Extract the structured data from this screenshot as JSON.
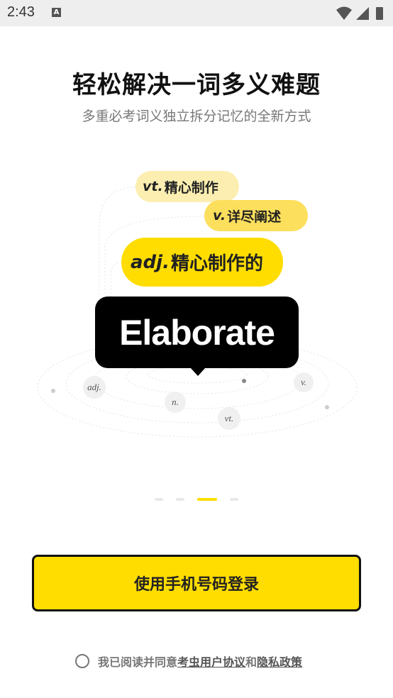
{
  "status_bar": {
    "time": "2:43",
    "notification_glyph": "A",
    "icons": [
      "wifi-icon",
      "cell-signal-icon",
      "battery-icon"
    ]
  },
  "headline": {
    "title": "轻松解决一词多义难题",
    "subtitle": "多重必考词义独立拆分记忆的全新方式"
  },
  "illustration": {
    "word": "Elaborate",
    "meanings": [
      {
        "pos": "vt.",
        "text": "精心制作"
      },
      {
        "pos": "v.",
        "text": "详尽阐述"
      },
      {
        "pos": "adj.",
        "text": "精心制作的"
      }
    ],
    "orbit_labels": [
      "adj.",
      "n.",
      "vt.",
      "v."
    ]
  },
  "pager": {
    "count": 4,
    "active_index": 2,
    "active_color": "#ffdd00",
    "inactive_color": "#e8e8e8"
  },
  "login": {
    "button_label": "使用手机号码登录"
  },
  "agreement": {
    "prefix": "我已阅读并同意",
    "user_agreement": "考虫用户协议",
    "and": "和",
    "privacy_policy": "隐私政策"
  },
  "colors": {
    "accent": "#ffdd00",
    "text_primary": "#111111",
    "text_secondary": "#777777"
  }
}
